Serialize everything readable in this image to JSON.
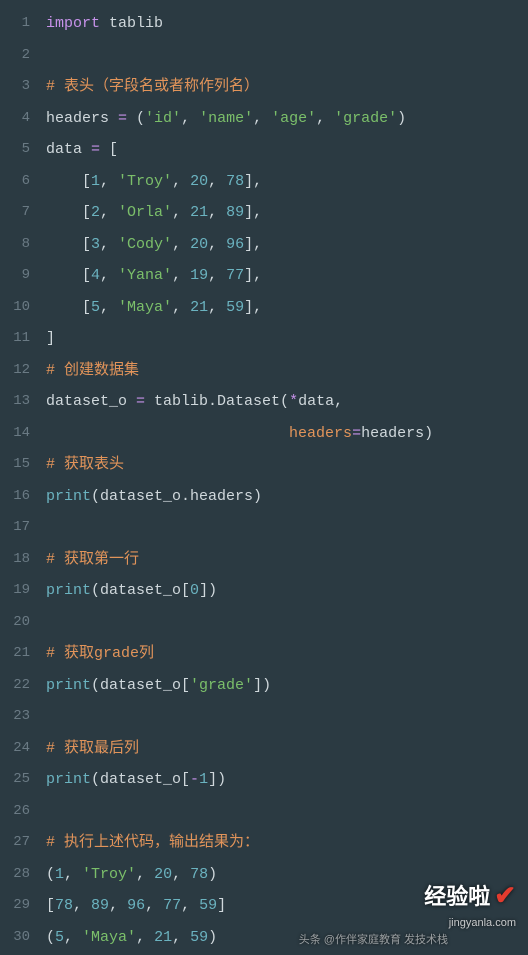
{
  "lines": [
    {
      "n": "1",
      "tokens": [
        {
          "t": "import ",
          "c": "keyword"
        },
        {
          "t": "tablib",
          "c": "module"
        }
      ]
    },
    {
      "n": "2",
      "tokens": []
    },
    {
      "n": "3",
      "tokens": [
        {
          "t": "# 表头（字段名或者称作列名）",
          "c": "comment"
        }
      ]
    },
    {
      "n": "4",
      "tokens": [
        {
          "t": "headers ",
          "c": "ident"
        },
        {
          "t": "= ",
          "c": "op"
        },
        {
          "t": "(",
          "c": "punct"
        },
        {
          "t": "'id'",
          "c": "string"
        },
        {
          "t": ", ",
          "c": "punct"
        },
        {
          "t": "'name'",
          "c": "string"
        },
        {
          "t": ", ",
          "c": "punct"
        },
        {
          "t": "'age'",
          "c": "string"
        },
        {
          "t": ", ",
          "c": "punct"
        },
        {
          "t": "'grade'",
          "c": "string"
        },
        {
          "t": ")",
          "c": "punct"
        }
      ]
    },
    {
      "n": "5",
      "tokens": [
        {
          "t": "data ",
          "c": "ident"
        },
        {
          "t": "= ",
          "c": "op"
        },
        {
          "t": "[",
          "c": "punct"
        }
      ]
    },
    {
      "n": "6",
      "tokens": [
        {
          "t": "    [",
          "c": "punct"
        },
        {
          "t": "1",
          "c": "number"
        },
        {
          "t": ", ",
          "c": "punct"
        },
        {
          "t": "'Troy'",
          "c": "string"
        },
        {
          "t": ", ",
          "c": "punct"
        },
        {
          "t": "20",
          "c": "number"
        },
        {
          "t": ", ",
          "c": "punct"
        },
        {
          "t": "78",
          "c": "number"
        },
        {
          "t": "],",
          "c": "punct"
        }
      ]
    },
    {
      "n": "7",
      "tokens": [
        {
          "t": "    [",
          "c": "punct"
        },
        {
          "t": "2",
          "c": "number"
        },
        {
          "t": ", ",
          "c": "punct"
        },
        {
          "t": "'Orla'",
          "c": "string"
        },
        {
          "t": ", ",
          "c": "punct"
        },
        {
          "t": "21",
          "c": "number"
        },
        {
          "t": ", ",
          "c": "punct"
        },
        {
          "t": "89",
          "c": "number"
        },
        {
          "t": "],",
          "c": "punct"
        }
      ]
    },
    {
      "n": "8",
      "tokens": [
        {
          "t": "    [",
          "c": "punct"
        },
        {
          "t": "3",
          "c": "number"
        },
        {
          "t": ", ",
          "c": "punct"
        },
        {
          "t": "'Cody'",
          "c": "string"
        },
        {
          "t": ", ",
          "c": "punct"
        },
        {
          "t": "20",
          "c": "number"
        },
        {
          "t": ", ",
          "c": "punct"
        },
        {
          "t": "96",
          "c": "number"
        },
        {
          "t": "],",
          "c": "punct"
        }
      ]
    },
    {
      "n": "9",
      "tokens": [
        {
          "t": "    [",
          "c": "punct"
        },
        {
          "t": "4",
          "c": "number"
        },
        {
          "t": ", ",
          "c": "punct"
        },
        {
          "t": "'Yana'",
          "c": "string"
        },
        {
          "t": ", ",
          "c": "punct"
        },
        {
          "t": "19",
          "c": "number"
        },
        {
          "t": ", ",
          "c": "punct"
        },
        {
          "t": "77",
          "c": "number"
        },
        {
          "t": "],",
          "c": "punct"
        }
      ]
    },
    {
      "n": "10",
      "tokens": [
        {
          "t": "    [",
          "c": "punct"
        },
        {
          "t": "5",
          "c": "number"
        },
        {
          "t": ", ",
          "c": "punct"
        },
        {
          "t": "'Maya'",
          "c": "string"
        },
        {
          "t": ", ",
          "c": "punct"
        },
        {
          "t": "21",
          "c": "number"
        },
        {
          "t": ", ",
          "c": "punct"
        },
        {
          "t": "59",
          "c": "number"
        },
        {
          "t": "],",
          "c": "punct"
        }
      ]
    },
    {
      "n": "11",
      "tokens": [
        {
          "t": "]",
          "c": "punct"
        }
      ]
    },
    {
      "n": "12",
      "tokens": [
        {
          "t": "# 创建数据集",
          "c": "comment"
        }
      ]
    },
    {
      "n": "13",
      "tokens": [
        {
          "t": "dataset_o ",
          "c": "ident"
        },
        {
          "t": "= ",
          "c": "op"
        },
        {
          "t": "tablib.Dataset(",
          "c": "ident"
        },
        {
          "t": "*",
          "c": "op"
        },
        {
          "t": "data,",
          "c": "ident"
        }
      ]
    },
    {
      "n": "14",
      "tokens": [
        {
          "t": "                           ",
          "c": "ident"
        },
        {
          "t": "headers",
          "c": "param"
        },
        {
          "t": "=",
          "c": "op"
        },
        {
          "t": "headers)",
          "c": "ident"
        }
      ]
    },
    {
      "n": "15",
      "tokens": [
        {
          "t": "# 获取表头",
          "c": "comment"
        }
      ]
    },
    {
      "n": "16",
      "tokens": [
        {
          "t": "print",
          "c": "func"
        },
        {
          "t": "(dataset_o.headers)",
          "c": "ident"
        }
      ]
    },
    {
      "n": "17",
      "tokens": []
    },
    {
      "n": "18",
      "tokens": [
        {
          "t": "# 获取第一行",
          "c": "comment"
        }
      ]
    },
    {
      "n": "19",
      "tokens": [
        {
          "t": "print",
          "c": "func"
        },
        {
          "t": "(dataset_o[",
          "c": "ident"
        },
        {
          "t": "0",
          "c": "number"
        },
        {
          "t": "])",
          "c": "ident"
        }
      ]
    },
    {
      "n": "20",
      "tokens": []
    },
    {
      "n": "21",
      "tokens": [
        {
          "t": "# 获取grade列",
          "c": "comment"
        }
      ]
    },
    {
      "n": "22",
      "tokens": [
        {
          "t": "print",
          "c": "func"
        },
        {
          "t": "(dataset_o[",
          "c": "ident"
        },
        {
          "t": "'grade'",
          "c": "string"
        },
        {
          "t": "])",
          "c": "ident"
        }
      ]
    },
    {
      "n": "23",
      "tokens": []
    },
    {
      "n": "24",
      "tokens": [
        {
          "t": "# 获取最后列",
          "c": "comment"
        }
      ]
    },
    {
      "n": "25",
      "tokens": [
        {
          "t": "print",
          "c": "func"
        },
        {
          "t": "(dataset_o[",
          "c": "ident"
        },
        {
          "t": "-",
          "c": "op"
        },
        {
          "t": "1",
          "c": "number"
        },
        {
          "t": "])",
          "c": "ident"
        }
      ]
    },
    {
      "n": "26",
      "tokens": []
    },
    {
      "n": "27",
      "tokens": [
        {
          "t": "# 执行上述代码，输出结果为：",
          "c": "comment"
        }
      ]
    },
    {
      "n": "28",
      "tokens": [
        {
          "t": "(",
          "c": "punct"
        },
        {
          "t": "1",
          "c": "number"
        },
        {
          "t": ", ",
          "c": "punct"
        },
        {
          "t": "'Troy'",
          "c": "string"
        },
        {
          "t": ", ",
          "c": "punct"
        },
        {
          "t": "20",
          "c": "number"
        },
        {
          "t": ", ",
          "c": "punct"
        },
        {
          "t": "78",
          "c": "number"
        },
        {
          "t": ")",
          "c": "punct"
        }
      ]
    },
    {
      "n": "29",
      "tokens": [
        {
          "t": "[",
          "c": "punct"
        },
        {
          "t": "78",
          "c": "number"
        },
        {
          "t": ", ",
          "c": "punct"
        },
        {
          "t": "89",
          "c": "number"
        },
        {
          "t": ", ",
          "c": "punct"
        },
        {
          "t": "96",
          "c": "number"
        },
        {
          "t": ", ",
          "c": "punct"
        },
        {
          "t": "77",
          "c": "number"
        },
        {
          "t": ", ",
          "c": "punct"
        },
        {
          "t": "59",
          "c": "number"
        },
        {
          "t": "]",
          "c": "punct"
        }
      ]
    },
    {
      "n": "30",
      "tokens": [
        {
          "t": "(",
          "c": "punct"
        },
        {
          "t": "5",
          "c": "number"
        },
        {
          "t": ", ",
          "c": "punct"
        },
        {
          "t": "'Maya'",
          "c": "string"
        },
        {
          "t": ", ",
          "c": "punct"
        },
        {
          "t": "21",
          "c": "number"
        },
        {
          "t": ", ",
          "c": "punct"
        },
        {
          "t": "59",
          "c": "number"
        },
        {
          "t": ")",
          "c": "punct"
        }
      ]
    }
  ],
  "watermark": {
    "logo_text": "经验啦",
    "check": "✔",
    "url": "jingyanla.com",
    "toutiao": "头条 @作伴家庭教育  发技术栈"
  }
}
